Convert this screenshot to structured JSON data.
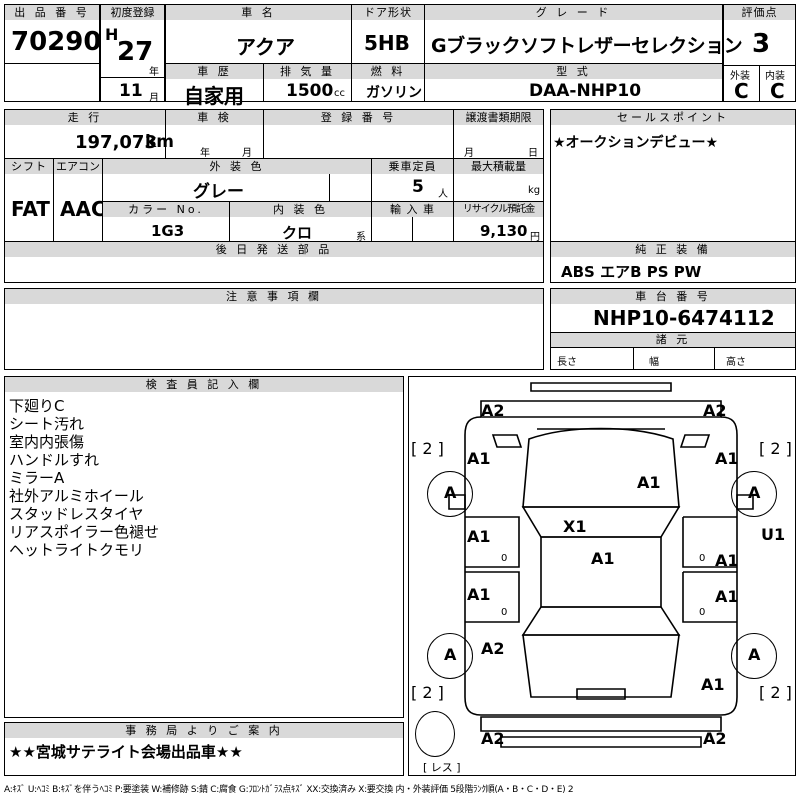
{
  "header": {
    "lot_label": "出 品 番 号",
    "lot_number": "70290",
    "first_reg_label": "初度登録",
    "era": "H",
    "year": "27",
    "year_unit": "年",
    "month": "11",
    "month_unit": "月",
    "car_name_label": "車 名",
    "car_name": "アクア",
    "door_label": "ドア形状",
    "door": "5HB",
    "grade_label": "グ レ ー ド",
    "grade": "Gブラックソフトレザーセレクション",
    "score_label": "評価点",
    "score": "3",
    "history_label": "車 歴",
    "history": "自家用",
    "displacement_label": "排 気 量",
    "displacement": "1500",
    "displacement_unit": "cc",
    "fuel_label": "燃 料",
    "fuel": "ガソリン",
    "model_label": "型 式",
    "model": "DAA-NHP10",
    "ext_label": "外装",
    "ext_grade": "C",
    "int_label": "内装",
    "int_grade": "C"
  },
  "row2": {
    "mileage_label": "走 行",
    "mileage": "197,073",
    "mileage_unit": "km",
    "inspection_label": "車 検",
    "year_unit": "年",
    "month_unit": "月",
    "plate_label": "登 録 番 号",
    "transfer_label": "譲渡書類期限",
    "day_unit": "日",
    "shift_label": "シフト",
    "shift": "FAT",
    "ac_label": "エアコン",
    "ac": "AAC",
    "color_label": "外 装 色",
    "color": "グレー",
    "capacity_label": "乗車定員",
    "capacity": "5",
    "capacity_unit": "人",
    "load_label": "最大積載量",
    "load_unit": "kg",
    "color_no_label": "カラー No.",
    "color_no": "1G3",
    "interior_label": "内 装 色",
    "interior": "クロ",
    "interior_unit": "系",
    "import_label": "輸 入 車",
    "recycle_label": "リサイクル預託金",
    "recycle": "9,130",
    "recycle_unit": "円",
    "later_label": "後 日 発 送 部 品"
  },
  "sales": {
    "label": "セールスポイント",
    "text": "★オークションデビュー★"
  },
  "equipment": {
    "label": "純 正 装 備",
    "text": "ABS エアB PS PW"
  },
  "notes": {
    "label": "注 意 事 項 欄"
  },
  "chassis": {
    "label": "車 台 番 号",
    "number": "NHP10-6474112",
    "dims_label": "諸 元",
    "length": "長さ",
    "width": "幅",
    "height": "高さ"
  },
  "inspector": {
    "label": "検 査 員 記 入 欄",
    "lines": [
      "下廻りC",
      "シート汚れ",
      "室内内張傷",
      "ハンドルすれ",
      "ミラーA",
      "社外アルミホイール",
      "スタッドレスタイヤ",
      "リアスポイラー色褪せ",
      "ヘットライトクモリ"
    ]
  },
  "diagram": {
    "marks": {
      "front_left": "A2",
      "front_right": "A2",
      "bracket_tl": "[ 2 ]",
      "bracket_tr": "[ 2 ]",
      "bracket_bl": "[ 2 ]",
      "bracket_br": "[ 2 ]",
      "fender_fl": "A1",
      "fender_fr": "A1",
      "wheel_fl": "A",
      "wheel_fr": "A",
      "wheel_rl": "A",
      "wheel_rr": "A",
      "hood": "A1",
      "roof": "X1",
      "roof2": "A1",
      "door_fl": "A1",
      "door_fr": "A1",
      "door_rl": "A1",
      "door_rr": "A1",
      "zero_fl": "0",
      "zero_fr": "0",
      "zero_rl": "0",
      "zero_rr": "0",
      "u1": "U1",
      "rear_fender_l": "A2",
      "rear_right": "A1",
      "rear_left": "A2",
      "rear_right2": "A2",
      "spare": "[ レス ]"
    }
  },
  "office": {
    "label": "事 務 局 よ り ご 案 内",
    "text": "★★宮城サテライト会場出品車★★"
  },
  "legend": "A:ｷｽﾞ U:ﾍｺﾐ B:ｷｽﾞを伴うﾍｺﾐ P:要塗装 W:補修跡 S:錆 C:腐食 G:ﾌﾛﾝﾄｶﾞﾗｽ点ｷｽﾞ XX:交換済み X:要交換 内・外装評価 5段階ﾗﾝｸ順(A・B・C・D・E) 2"
}
